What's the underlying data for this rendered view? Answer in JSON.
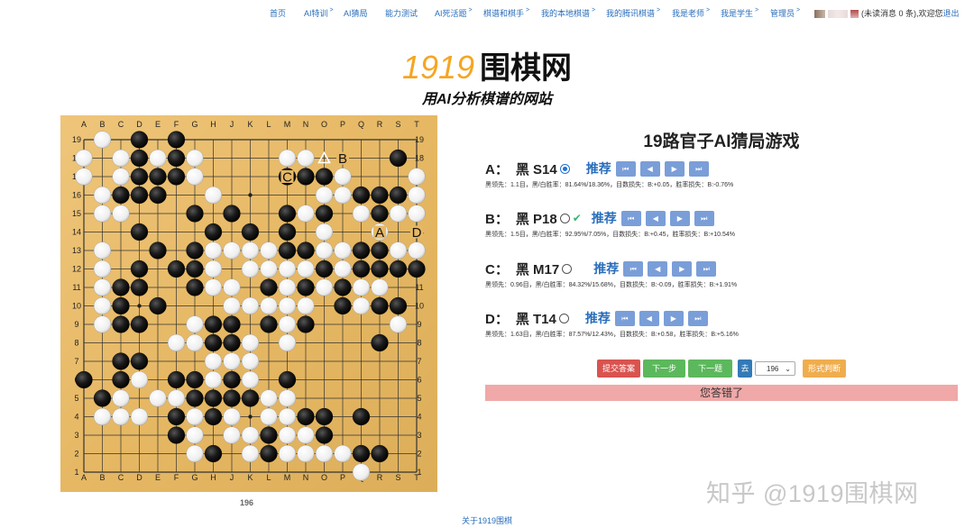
{
  "nav": {
    "items": [
      {
        "label": "首页",
        "caret": false
      },
      {
        "label": "AI特训",
        "caret": true
      },
      {
        "label": "AI猜局",
        "caret": false
      },
      {
        "label": "能力测试",
        "caret": false
      },
      {
        "label": "AI死活题",
        "caret": true
      },
      {
        "label": "棋谱和棋手",
        "caret": true
      },
      {
        "label": "我的本地棋谱",
        "caret": true
      },
      {
        "label": "我的腾讯棋谱",
        "caret": true
      },
      {
        "label": "我是老师",
        "caret": true
      },
      {
        "label": "我是学生",
        "caret": true
      },
      {
        "label": "管理员",
        "caret": true
      }
    ],
    "user_text": "(未读消息 0 条),欢迎您",
    "logout": "退出"
  },
  "logo": {
    "number": "1919",
    "name": "围棋网"
  },
  "tagline": "用AI分析棋谱的网站",
  "board": {
    "cols": [
      "A",
      "B",
      "C",
      "D",
      "E",
      "F",
      "G",
      "H",
      "J",
      "K",
      "L",
      "M",
      "N",
      "O",
      "P",
      "Q",
      "R",
      "S",
      "T"
    ],
    "rows": [
      "19",
      "18",
      "17",
      "16",
      "15",
      "14",
      "13",
      "12",
      "11",
      "10",
      "9",
      "8",
      "7",
      "6",
      "5",
      "4",
      "3",
      "2",
      "1"
    ],
    "stones": [
      {
        "p": "B19",
        "c": "w"
      },
      {
        "p": "D19",
        "c": "b"
      },
      {
        "p": "F19",
        "c": "b"
      },
      {
        "p": "A18",
        "c": "w"
      },
      {
        "p": "C18",
        "c": "w"
      },
      {
        "p": "D18",
        "c": "b"
      },
      {
        "p": "E18",
        "c": "w"
      },
      {
        "p": "F18",
        "c": "b"
      },
      {
        "p": "G18",
        "c": "w"
      },
      {
        "p": "M18",
        "c": "w"
      },
      {
        "p": "N18",
        "c": "w"
      },
      {
        "p": "S18",
        "c": "b"
      },
      {
        "p": "A17",
        "c": "w"
      },
      {
        "p": "C17",
        "c": "w"
      },
      {
        "p": "D17",
        "c": "b"
      },
      {
        "p": "E17",
        "c": "b"
      },
      {
        "p": "F17",
        "c": "b"
      },
      {
        "p": "G17",
        "c": "w"
      },
      {
        "p": "M17",
        "c": "b"
      },
      {
        "p": "N17",
        "c": "b"
      },
      {
        "p": "O17",
        "c": "b"
      },
      {
        "p": "P17",
        "c": "w"
      },
      {
        "p": "T17",
        "c": "w"
      },
      {
        "p": "B16",
        "c": "w"
      },
      {
        "p": "C16",
        "c": "b"
      },
      {
        "p": "D16",
        "c": "b"
      },
      {
        "p": "E16",
        "c": "b"
      },
      {
        "p": "H16",
        "c": "w"
      },
      {
        "p": "O16",
        "c": "w"
      },
      {
        "p": "P16",
        "c": "w"
      },
      {
        "p": "Q16",
        "c": "b"
      },
      {
        "p": "R16",
        "c": "b"
      },
      {
        "p": "S16",
        "c": "b"
      },
      {
        "p": "T16",
        "c": "w"
      },
      {
        "p": "B15",
        "c": "w"
      },
      {
        "p": "C15",
        "c": "w"
      },
      {
        "p": "G15",
        "c": "b"
      },
      {
        "p": "J15",
        "c": "b"
      },
      {
        "p": "M15",
        "c": "b"
      },
      {
        "p": "N15",
        "c": "w"
      },
      {
        "p": "O15",
        "c": "b"
      },
      {
        "p": "Q15",
        "c": "w"
      },
      {
        "p": "R15",
        "c": "b"
      },
      {
        "p": "S15",
        "c": "w"
      },
      {
        "p": "T15",
        "c": "w"
      },
      {
        "p": "D14",
        "c": "b"
      },
      {
        "p": "H14",
        "c": "b"
      },
      {
        "p": "K14",
        "c": "b"
      },
      {
        "p": "M14",
        "c": "b"
      },
      {
        "p": "O14",
        "c": "w"
      },
      {
        "p": "R14",
        "c": "w"
      },
      {
        "p": "B13",
        "c": "w"
      },
      {
        "p": "E13",
        "c": "b"
      },
      {
        "p": "G13",
        "c": "b"
      },
      {
        "p": "H13",
        "c": "w"
      },
      {
        "p": "J13",
        "c": "w"
      },
      {
        "p": "K13",
        "c": "w"
      },
      {
        "p": "L13",
        "c": "w"
      },
      {
        "p": "M13",
        "c": "b"
      },
      {
        "p": "N13",
        "c": "b"
      },
      {
        "p": "O13",
        "c": "w"
      },
      {
        "p": "P13",
        "c": "w"
      },
      {
        "p": "Q13",
        "c": "b"
      },
      {
        "p": "R13",
        "c": "b"
      },
      {
        "p": "S13",
        "c": "w"
      },
      {
        "p": "T13",
        "c": "w"
      },
      {
        "p": "B12",
        "c": "w"
      },
      {
        "p": "D12",
        "c": "b"
      },
      {
        "p": "F12",
        "c": "b"
      },
      {
        "p": "G12",
        "c": "b"
      },
      {
        "p": "H12",
        "c": "w"
      },
      {
        "p": "K12",
        "c": "w"
      },
      {
        "p": "L12",
        "c": "w"
      },
      {
        "p": "M12",
        "c": "w"
      },
      {
        "p": "N12",
        "c": "w"
      },
      {
        "p": "O12",
        "c": "b"
      },
      {
        "p": "P12",
        "c": "w"
      },
      {
        "p": "Q12",
        "c": "b"
      },
      {
        "p": "R12",
        "c": "b"
      },
      {
        "p": "S12",
        "c": "b"
      },
      {
        "p": "T12",
        "c": "b"
      },
      {
        "p": "B11",
        "c": "w"
      },
      {
        "p": "C11",
        "c": "b"
      },
      {
        "p": "D11",
        "c": "b"
      },
      {
        "p": "G11",
        "c": "b"
      },
      {
        "p": "H11",
        "c": "w"
      },
      {
        "p": "J11",
        "c": "w"
      },
      {
        "p": "L11",
        "c": "b"
      },
      {
        "p": "M11",
        "c": "w"
      },
      {
        "p": "N11",
        "c": "b"
      },
      {
        "p": "O11",
        "c": "w"
      },
      {
        "p": "P11",
        "c": "b"
      },
      {
        "p": "Q11",
        "c": "w"
      },
      {
        "p": "R11",
        "c": "w"
      },
      {
        "p": "B10",
        "c": "w"
      },
      {
        "p": "C10",
        "c": "b"
      },
      {
        "p": "E10",
        "c": "b"
      },
      {
        "p": "J10",
        "c": "w"
      },
      {
        "p": "K10",
        "c": "w"
      },
      {
        "p": "L10",
        "c": "w"
      },
      {
        "p": "M10",
        "c": "w"
      },
      {
        "p": "N10",
        "c": "w"
      },
      {
        "p": "P10",
        "c": "b"
      },
      {
        "p": "Q10",
        "c": "w"
      },
      {
        "p": "R10",
        "c": "b"
      },
      {
        "p": "S10",
        "c": "b"
      },
      {
        "p": "B9",
        "c": "w"
      },
      {
        "p": "C9",
        "c": "b"
      },
      {
        "p": "D9",
        "c": "b"
      },
      {
        "p": "G9",
        "c": "w"
      },
      {
        "p": "H9",
        "c": "b"
      },
      {
        "p": "J9",
        "c": "b"
      },
      {
        "p": "L9",
        "c": "b"
      },
      {
        "p": "M9",
        "c": "w"
      },
      {
        "p": "N9",
        "c": "b"
      },
      {
        "p": "S9",
        "c": "w"
      },
      {
        "p": "F8",
        "c": "w"
      },
      {
        "p": "G8",
        "c": "w"
      },
      {
        "p": "H8",
        "c": "b"
      },
      {
        "p": "J8",
        "c": "b"
      },
      {
        "p": "K8",
        "c": "w"
      },
      {
        "p": "M8",
        "c": "w"
      },
      {
        "p": "R8",
        "c": "b"
      },
      {
        "p": "C7",
        "c": "b"
      },
      {
        "p": "D7",
        "c": "b"
      },
      {
        "p": "H7",
        "c": "w"
      },
      {
        "p": "J7",
        "c": "w"
      },
      {
        "p": "K7",
        "c": "w"
      },
      {
        "p": "A6",
        "c": "b"
      },
      {
        "p": "C6",
        "c": "b"
      },
      {
        "p": "D6",
        "c": "w"
      },
      {
        "p": "F6",
        "c": "b"
      },
      {
        "p": "G6",
        "c": "b"
      },
      {
        "p": "H6",
        "c": "w"
      },
      {
        "p": "J6",
        "c": "b"
      },
      {
        "p": "K6",
        "c": "w"
      },
      {
        "p": "M6",
        "c": "b"
      },
      {
        "p": "B5",
        "c": "b"
      },
      {
        "p": "C5",
        "c": "w"
      },
      {
        "p": "E5",
        "c": "w"
      },
      {
        "p": "F5",
        "c": "w"
      },
      {
        "p": "G5",
        "c": "b"
      },
      {
        "p": "H5",
        "c": "b"
      },
      {
        "p": "J5",
        "c": "b"
      },
      {
        "p": "K5",
        "c": "b"
      },
      {
        "p": "L5",
        "c": "w"
      },
      {
        "p": "M5",
        "c": "w"
      },
      {
        "p": "B4",
        "c": "w"
      },
      {
        "p": "C4",
        "c": "w"
      },
      {
        "p": "D4",
        "c": "w"
      },
      {
        "p": "F4",
        "c": "b"
      },
      {
        "p": "G4",
        "c": "w"
      },
      {
        "p": "H4",
        "c": "b"
      },
      {
        "p": "J4",
        "c": "w"
      },
      {
        "p": "L4",
        "c": "w"
      },
      {
        "p": "M4",
        "c": "w"
      },
      {
        "p": "N4",
        "c": "b"
      },
      {
        "p": "O4",
        "c": "b"
      },
      {
        "p": "Q4",
        "c": "b"
      },
      {
        "p": "F3",
        "c": "b"
      },
      {
        "p": "G3",
        "c": "w"
      },
      {
        "p": "J3",
        "c": "w"
      },
      {
        "p": "K3",
        "c": "w"
      },
      {
        "p": "L3",
        "c": "b"
      },
      {
        "p": "M3",
        "c": "w"
      },
      {
        "p": "N3",
        "c": "w"
      },
      {
        "p": "O3",
        "c": "b"
      },
      {
        "p": "G2",
        "c": "w"
      },
      {
        "p": "H2",
        "c": "b"
      },
      {
        "p": "K2",
        "c": "w"
      },
      {
        "p": "L2",
        "c": "b"
      },
      {
        "p": "M2",
        "c": "w"
      },
      {
        "p": "N2",
        "c": "w"
      },
      {
        "p": "O2",
        "c": "w"
      },
      {
        "p": "P2",
        "c": "w"
      },
      {
        "p": "Q2",
        "c": "b"
      },
      {
        "p": "R2",
        "c": "b"
      },
      {
        "p": "Q1",
        "c": "w"
      }
    ],
    "markers": [
      {
        "p": "O18",
        "type": "triangle"
      },
      {
        "p": "P18",
        "type": "label",
        "text": "B"
      },
      {
        "p": "M17",
        "type": "label",
        "text": "C"
      },
      {
        "p": "R14",
        "type": "label",
        "text": "A"
      },
      {
        "p": "T14",
        "type": "label",
        "text": "D"
      }
    ],
    "move_count": "196"
  },
  "game": {
    "title": "19路官子AI猜局游戏",
    "recommend_label": "推荐",
    "nav_icons": [
      "first-icon",
      "prev-icon",
      "next-icon",
      "last-icon"
    ],
    "options": [
      {
        "letter": "A：",
        "move": "黑 S14",
        "selected": true,
        "correct": false,
        "stats": "黑领先：1.1目，黑/白胜率：81.64%/18.36%，目数损失：B:+0.05，胜率损失：B:-0.76%"
      },
      {
        "letter": "B：",
        "move": "黑 P18",
        "selected": false,
        "correct": true,
        "stats": "黑领先：1.5目，黑/白胜率：92.95%/7.05%，目数损失：B:+0.45，胜率损失：B:+10.54%"
      },
      {
        "letter": "C：",
        "move": "黑 M17",
        "selected": false,
        "correct": false,
        "stats": "黑领先：0.96目，黑/白胜率：84.32%/15.68%，目数损失：B:-0.09，胜率损失：B:+1.91%"
      },
      {
        "letter": "D：",
        "move": "黑 T14",
        "selected": false,
        "correct": false,
        "stats": "黑领先：1.63目，黑/白胜率：87.57%/12.43%，目数损失：B:+0.58，胜率损失：B:+5.16%"
      }
    ]
  },
  "controls": {
    "submit": "提交答案",
    "next_step": "下一步",
    "next_question": "下一题",
    "go": "去",
    "move_select": "196",
    "judge": "形式判断"
  },
  "colors": {
    "submit": "#d9534f",
    "green": "#5cb85c",
    "go": "#337ab7",
    "judge": "#f0ad4e",
    "wrong_bg": "#f0a8a8",
    "board": "#e8bd6a",
    "link": "#2a6ebb"
  },
  "result": "您答错了",
  "footer": {
    "link": "关于1919围棋"
  },
  "watermark": "知乎 @1919围棋网"
}
